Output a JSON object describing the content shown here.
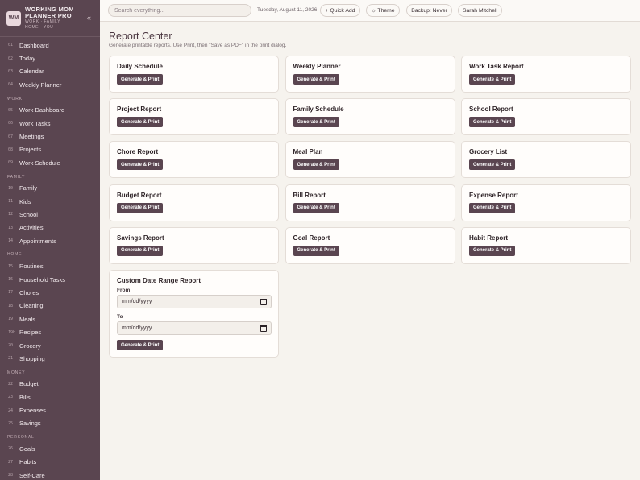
{
  "brand": {
    "logo_text": "WM",
    "title_line1": "WORKING MOM",
    "title_line2": "PLANNER PRO",
    "subtitle_line1": "WORK · FAMILY",
    "subtitle_line2": "HOME · YOU",
    "collapse_icon": "«"
  },
  "sidebar": {
    "groups": [
      {
        "label": "",
        "items": [
          {
            "num": "01",
            "label": "Dashboard"
          },
          {
            "num": "02",
            "label": "Today"
          },
          {
            "num": "03",
            "label": "Calendar"
          },
          {
            "num": "04",
            "label": "Weekly Planner"
          }
        ]
      },
      {
        "label": "WORK",
        "items": [
          {
            "num": "05",
            "label": "Work Dashboard"
          },
          {
            "num": "06",
            "label": "Work Tasks"
          },
          {
            "num": "07",
            "label": "Meetings"
          },
          {
            "num": "08",
            "label": "Projects"
          },
          {
            "num": "09",
            "label": "Work Schedule"
          }
        ]
      },
      {
        "label": "FAMILY",
        "items": [
          {
            "num": "10",
            "label": "Family"
          },
          {
            "num": "11",
            "label": "Kids"
          },
          {
            "num": "12",
            "label": "School"
          },
          {
            "num": "13",
            "label": "Activities"
          },
          {
            "num": "14",
            "label": "Appointments"
          }
        ]
      },
      {
        "label": "HOME",
        "items": [
          {
            "num": "15",
            "label": "Routines"
          },
          {
            "num": "16",
            "label": "Household Tasks"
          },
          {
            "num": "17",
            "label": "Chores"
          },
          {
            "num": "18",
            "label": "Cleaning"
          },
          {
            "num": "19",
            "label": "Meals"
          },
          {
            "num": "19b",
            "label": "Recipes"
          },
          {
            "num": "20",
            "label": "Grocery"
          },
          {
            "num": "21",
            "label": "Shopping"
          }
        ]
      },
      {
        "label": "MONEY",
        "items": [
          {
            "num": "22",
            "label": "Budget"
          },
          {
            "num": "23",
            "label": "Bills"
          },
          {
            "num": "24",
            "label": "Expenses"
          },
          {
            "num": "25",
            "label": "Savings"
          }
        ]
      },
      {
        "label": "PERSONAL",
        "items": [
          {
            "num": "26",
            "label": "Goals"
          },
          {
            "num": "27",
            "label": "Habits"
          },
          {
            "num": "28",
            "label": "Self-Care"
          }
        ]
      }
    ]
  },
  "topbar": {
    "search_placeholder": "Search everything...",
    "date": "Tuesday, August 11, 2026",
    "quick_add": "+ Quick Add",
    "theme": "☼ Theme",
    "backup": "Backup: Never",
    "user": "Sarah Mitchell"
  },
  "main": {
    "title": "Report Center",
    "subtitle": "Generate printable reports. Use Print, then \"Save as PDF\" in the print dialog.",
    "button_label": "Generate & Print",
    "reports": [
      "Daily Schedule",
      "Weekly Planner",
      "Work Task Report",
      "Project Report",
      "Family Schedule",
      "School Report",
      "Chore Report",
      "Meal Plan",
      "Grocery List",
      "Budget Report",
      "Bill Report",
      "Expense Report",
      "Savings Report",
      "Goal Report",
      "Habit Report"
    ],
    "custom": {
      "title": "Custom Date Range Report",
      "from_label": "From",
      "to_label": "To",
      "from_value": "mm/dd/yyyy",
      "to_value": "mm/dd/yyyy"
    }
  },
  "colors": {
    "sidebar_bg": "#5a4550",
    "accent": "#5a4550",
    "page_bg": "#f6f3ee"
  }
}
